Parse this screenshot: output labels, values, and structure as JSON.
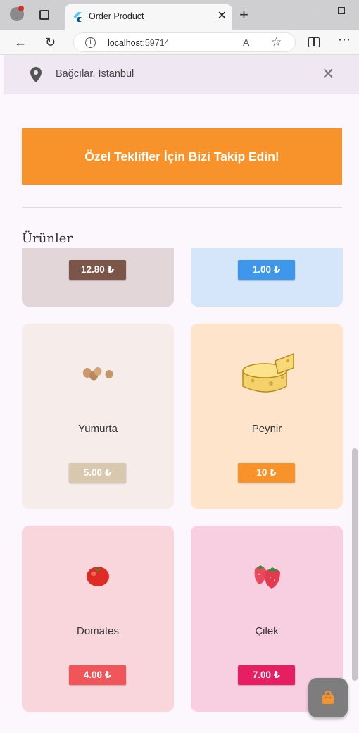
{
  "browser": {
    "tab_title": "Order Product",
    "url_host": "localhost",
    "url_port": ":59714"
  },
  "header": {
    "location": "Bağcılar, İstanbul",
    "close_icon": "close-icon",
    "pin_icon": "location-pin-icon"
  },
  "banner": {
    "text": "Özel Teklifler İçin Bizi Takip Edin!",
    "color": "#f7932a"
  },
  "section_title": "Ürünler",
  "products": [
    {
      "name": "",
      "price": "12.80 ₺",
      "card_color": "#e3d6d9",
      "price_color": "#7a5548",
      "icon": "partial-card"
    },
    {
      "name": "",
      "price": "1.00 ₺",
      "card_color": "#d6e6fa",
      "price_color": "#3e97eb",
      "icon": "partial-card"
    },
    {
      "name": "Yumurta",
      "price": "5.00 ₺",
      "card_color": "#f6ecea",
      "price_color": "#d8c8ad",
      "icon": "eggs-icon"
    },
    {
      "name": "Peynir",
      "price": "10 ₺",
      "card_color": "#fde4cb",
      "price_color": "#f7932a",
      "icon": "cheese-icon"
    },
    {
      "name": "Domates",
      "price": "4.00 ₺",
      "card_color": "#f9d5dc",
      "price_color": "#ef5559",
      "icon": "tomato-icon"
    },
    {
      "name": "Çilek",
      "price": "7.00 ₺",
      "card_color": "#f7cfe0",
      "price_color": "#e81e63",
      "icon": "strawberry-icon"
    }
  ],
  "fab": {
    "icon": "shopping-bag-icon",
    "color": "#7d7d7d"
  }
}
